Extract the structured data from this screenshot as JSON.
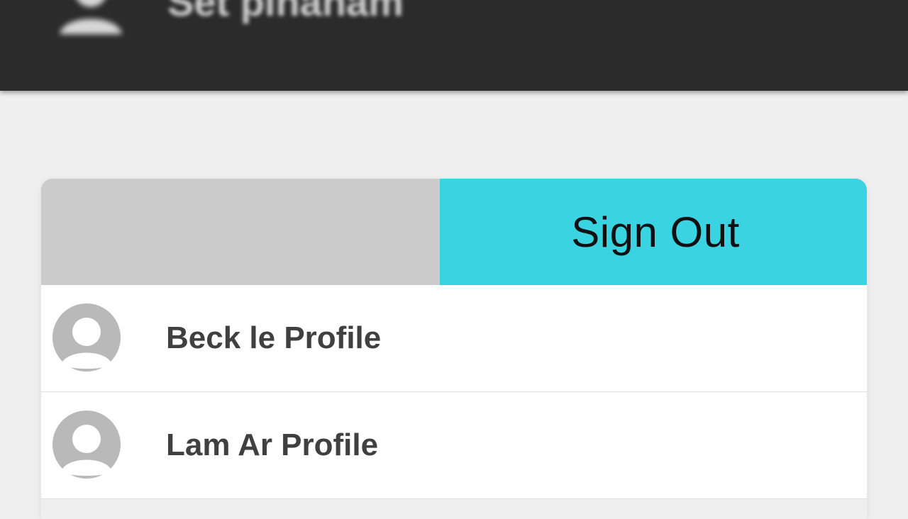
{
  "header": {
    "title": "Set pinanam",
    "avatar_icon": "user-avatar-icon"
  },
  "actions": {
    "signout_label": "Sign Out",
    "signout_color": "#3ad3e2",
    "blank_color": "#cbcbcb"
  },
  "profiles": [
    {
      "name": "Beck le Profile",
      "avatar_icon": "user-avatar-icon"
    },
    {
      "name": "Lam Ar Profile",
      "avatar_icon": "user-avatar-icon"
    }
  ]
}
